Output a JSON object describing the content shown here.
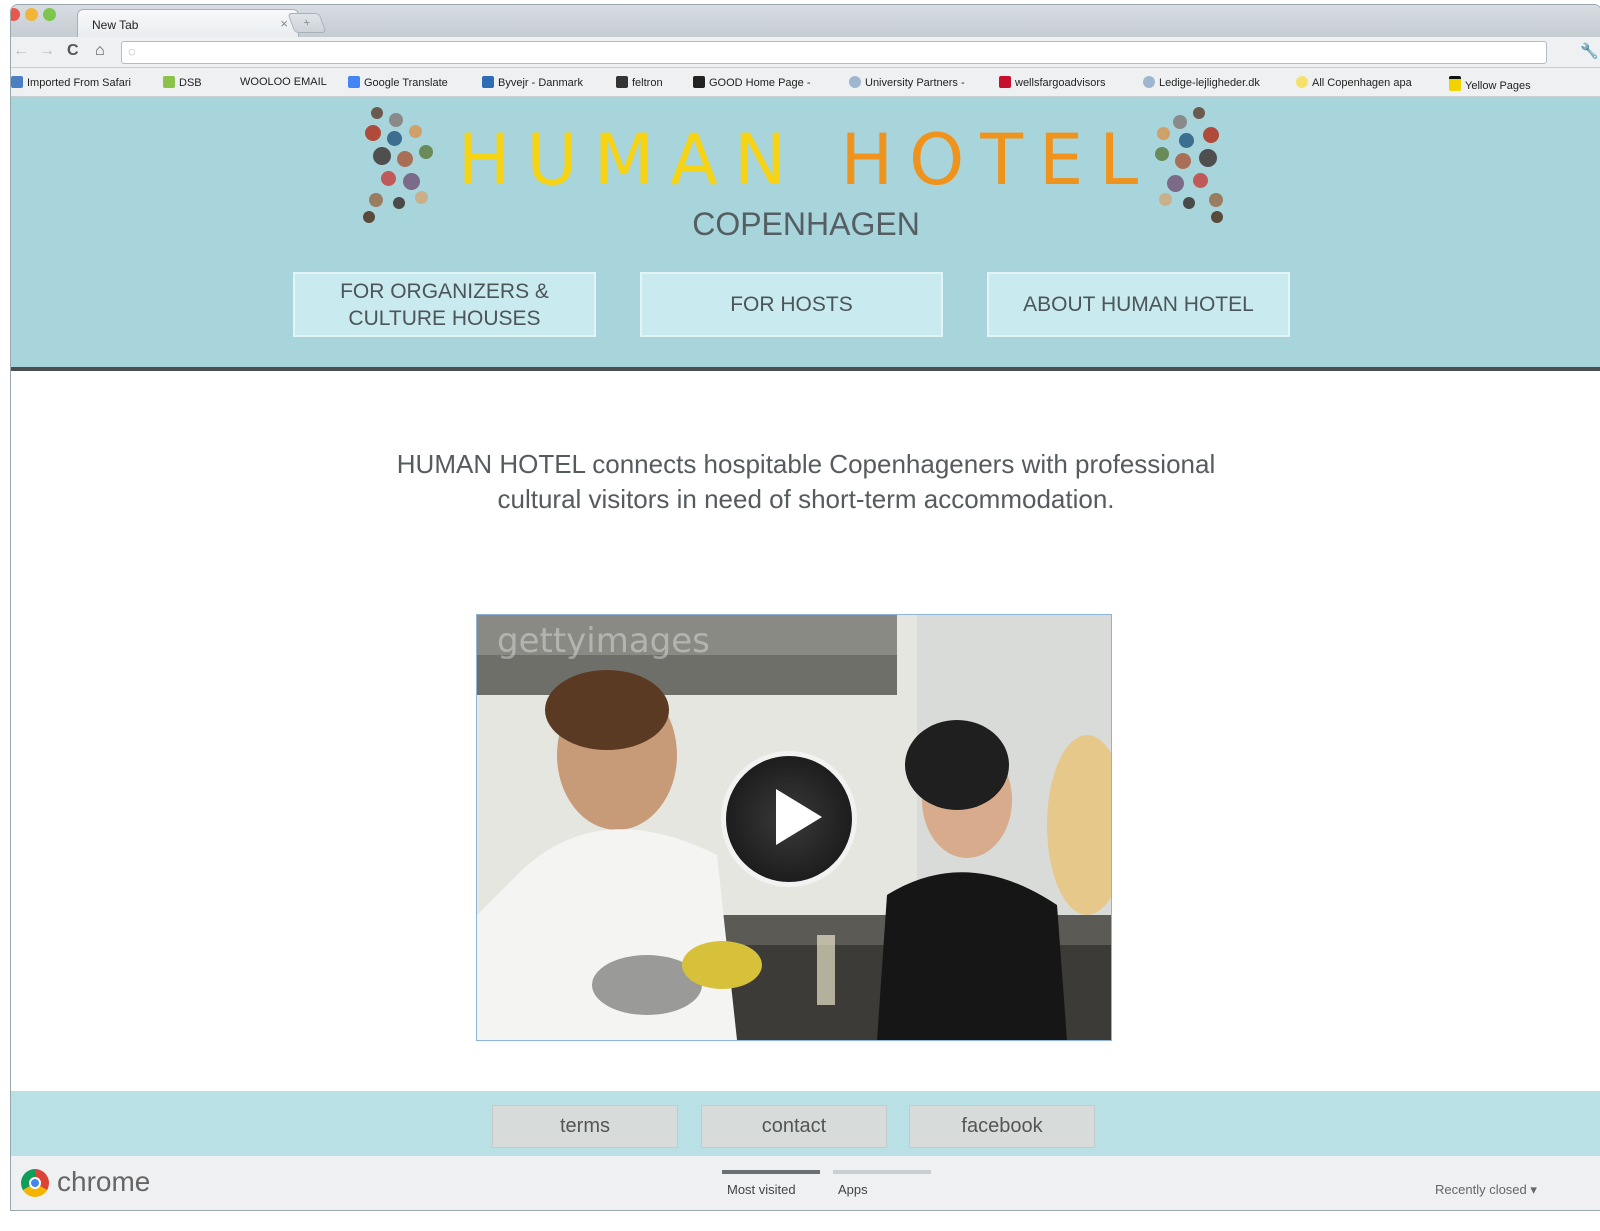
{
  "browser": {
    "tab_title": "New Tab",
    "tab_close": "×",
    "new_tab": "+",
    "nav": {
      "back": "←",
      "forward": "→",
      "reload": "C",
      "home": "⌂",
      "globe": "◌",
      "wrench": "🔧"
    }
  },
  "bookmarks": [
    {
      "label": "Imported From Safari",
      "color": "#4a7fc1"
    },
    {
      "label": "DSB",
      "color": "#8bc34a"
    },
    {
      "label": "WOOLOO EMAIL",
      "color": ""
    },
    {
      "label": "Google Translate",
      "color": "#4285f4"
    },
    {
      "label": "Byvejr - Danmark",
      "color": "#2e6cb5"
    },
    {
      "label": "feltron",
      "color": "#333333"
    },
    {
      "label": "GOOD Home Page -",
      "color": "#222222"
    },
    {
      "label": "University Partners -",
      "color": "#9fb6d0"
    },
    {
      "label": "wellsfargoadvisors",
      "color": "#c8102e"
    },
    {
      "label": "Ledige-lejligheder.dk",
      "color": "#9fb6d0"
    },
    {
      "label": "All Copenhagen apa",
      "color": "#f5e16b"
    },
    {
      "label": "Yellow Pages",
      "color": "#f2d300"
    }
  ],
  "header": {
    "logo_word1": "HUMAN",
    "logo_word2": "HOTEL",
    "city": "COPENHAGEN",
    "nav": [
      {
        "line1": "FOR ORGANIZERS &",
        "line2": "CULTURE HOUSES"
      },
      {
        "line1": "FOR HOSTS",
        "line2": ""
      },
      {
        "line1": "ABOUT HUMAN HOTEL",
        "line2": ""
      }
    ],
    "colors": {
      "bg": "#a7d5db",
      "logo_yellow": "#f7d316",
      "logo_orange": "#f0931c"
    }
  },
  "intro": {
    "line1": "HUMAN HOTEL connects hospitable Copenhageners with professional",
    "line2": "cultural visitors in need of short-term accommodation."
  },
  "video": {
    "watermark": "gettyimages",
    "play_icon": "play-icon"
  },
  "footer": {
    "buttons": [
      "terms",
      "contact",
      "facebook"
    ]
  },
  "bottombar": {
    "brand": "chrome",
    "tabs": [
      "Most visited",
      "Apps"
    ],
    "recently_closed": "Recently closed ▾"
  }
}
